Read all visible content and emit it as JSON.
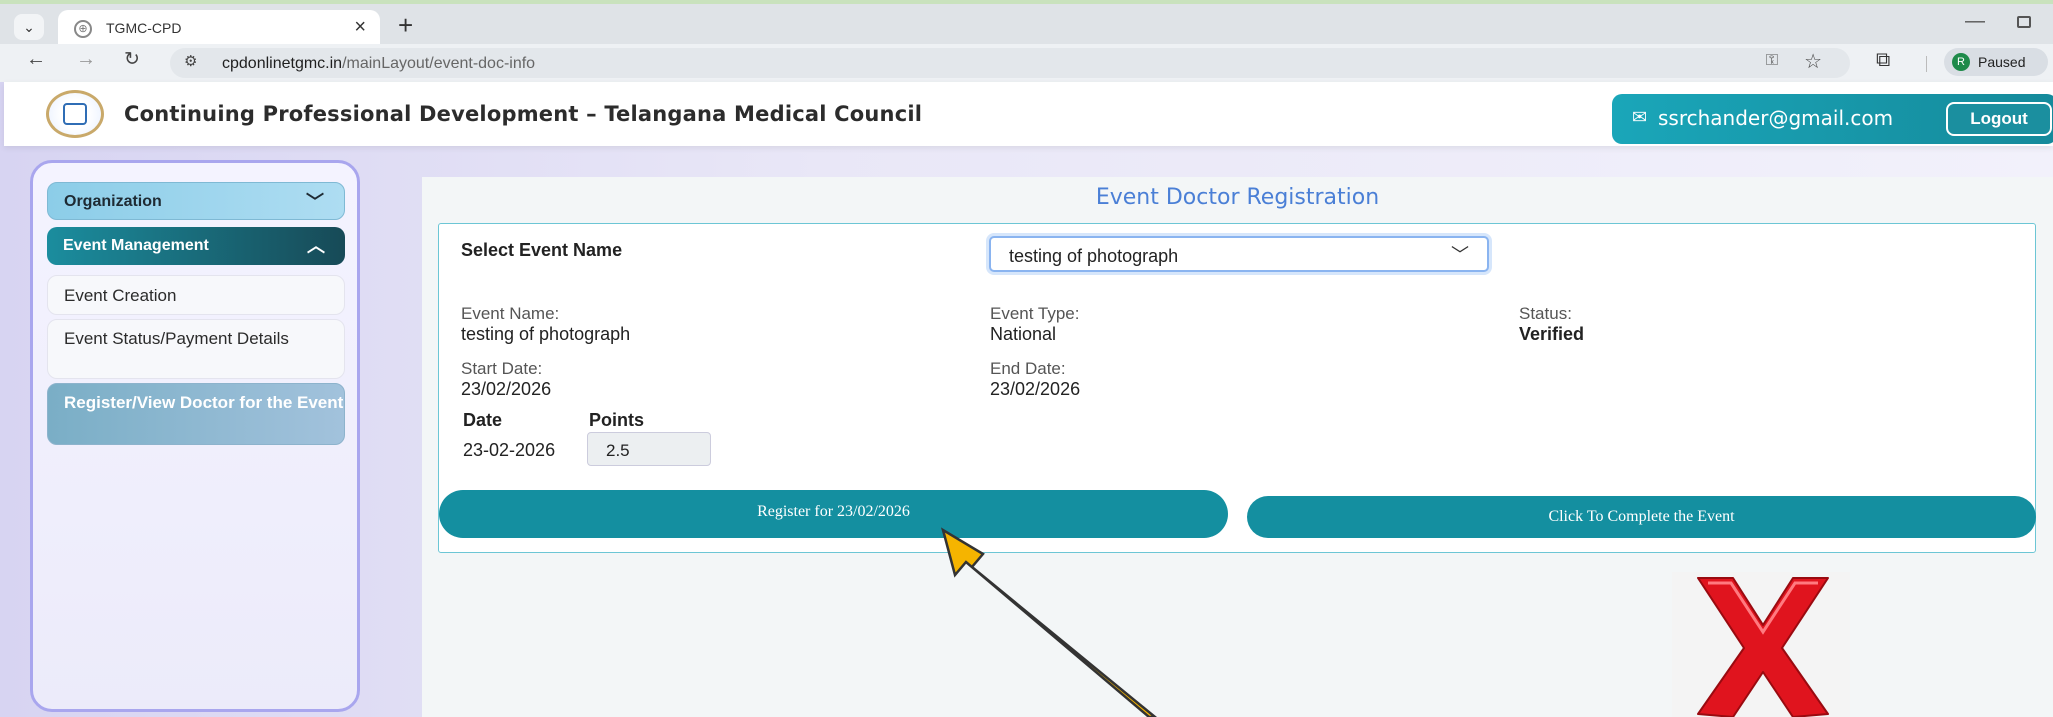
{
  "browser": {
    "tab_title": "TGMC-CPD",
    "tab_close": "×",
    "new_tab": "+",
    "url_host": "cpdonlinetgmc.in",
    "url_path": "/mainLayout/event-doc-info",
    "profile_initial": "R",
    "profile_status": "Paused",
    "icons": [
      "tab-menu-icon",
      "back-icon",
      "forward-icon",
      "reload-icon",
      "site-settings-icon",
      "password-key-icon",
      "star-icon",
      "extensions-icon",
      "minimize-icon",
      "restore-icon"
    ]
  },
  "header": {
    "title": "Continuing Professional Development – Telangana Medical Council",
    "user_email": "ssrchander@gmail.com",
    "logout_label": "Logout"
  },
  "sidebar": {
    "items": [
      {
        "label": "Organization"
      },
      {
        "label": "Event Management"
      },
      {
        "label": "Event Creation"
      },
      {
        "label": "Event Status/Payment Details"
      },
      {
        "label": "Register/View Doctor for the Event"
      }
    ]
  },
  "main": {
    "title": "Event Doctor Registration",
    "select_label": "Select Event Name",
    "selected_event": "testing of photograph",
    "details": {
      "event_name_label": "Event Name:",
      "event_name": "testing of photograph",
      "event_type_label": "Event Type:",
      "event_type": "National",
      "status_label": "Status:",
      "status": "Verified",
      "start_date_label": "Start Date:",
      "start_date": "23/02/2026",
      "end_date_label": "End Date:",
      "end_date": "23/02/2026"
    },
    "points_table": {
      "headers": [
        "Date",
        "Points"
      ],
      "row": {
        "date": "23-02-2026",
        "points": "2.5"
      }
    },
    "register_button": "Register for 23/02/2026",
    "complete_button": "Click To Complete the Event"
  },
  "annotations": {
    "arrow_color": "#f5b400",
    "cross_color": "#e0141e"
  }
}
